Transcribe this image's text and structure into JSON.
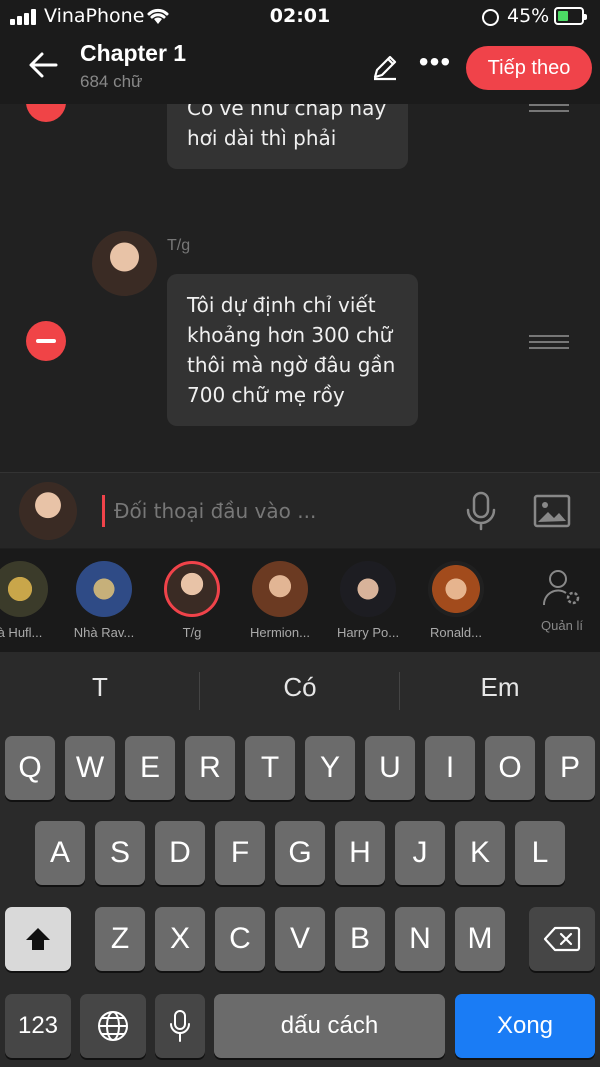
{
  "status": {
    "carrier": "VinaPhone",
    "time": "02:01",
    "battery": "45%"
  },
  "header": {
    "title": "Chapter 1",
    "subtitle": "684 chữ",
    "next_label": "Tiếp theo"
  },
  "messages": [
    {
      "text": "Có vẻ như chap này hơi dài thì phải"
    },
    {
      "speaker": "T/g",
      "text": "Tôi dự định chỉ viết khoảng hơn 300 chữ thôi mà ngờ đâu gần 700 chữ mẹ rồy"
    }
  ],
  "input": {
    "placeholder": "Đối thoại đầu vào ..."
  },
  "characters": [
    {
      "name": "à Hufl..."
    },
    {
      "name": "Nhà Rav..."
    },
    {
      "name": "T/g"
    },
    {
      "name": "Hermion..."
    },
    {
      "name": "Harry Po..."
    },
    {
      "name": "Ronald..."
    }
  ],
  "manage_label": "Quản lí",
  "keyboard": {
    "suggestions": [
      "T",
      "Có",
      "Em"
    ],
    "row1": [
      "Q",
      "W",
      "E",
      "R",
      "T",
      "Y",
      "U",
      "I",
      "O",
      "P"
    ],
    "row2": [
      "A",
      "S",
      "D",
      "F",
      "G",
      "H",
      "J",
      "K",
      "L"
    ],
    "row3": [
      "Z",
      "X",
      "C",
      "V",
      "B",
      "N",
      "M"
    ],
    "num_label": "123",
    "space_label": "dấu cách",
    "done_label": "Xong"
  }
}
